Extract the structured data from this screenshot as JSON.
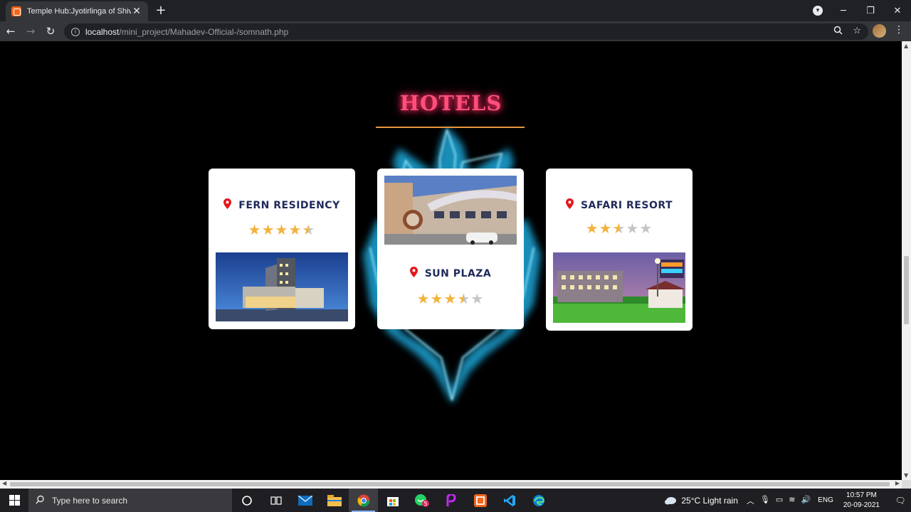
{
  "browser": {
    "tab_title": "Temple Hub:Jyotirlinga of Shiva",
    "tab_close": "✕",
    "new_tab": "+",
    "url_host": "localhost",
    "url_path": "/mini_project/Mahadev-Official-/somnath.php"
  },
  "page": {
    "section_title": "HOTELS",
    "hotels": [
      {
        "name": "FERN RESIDENCY",
        "rating": 4.5,
        "stars": [
          "full",
          "full",
          "full",
          "full",
          "half"
        ],
        "image": "hotel-building-blue-sky"
      },
      {
        "name": "SUN PLAZA",
        "rating": 3.5,
        "stars": [
          "full",
          "full",
          "full",
          "half",
          "empty"
        ],
        "image": "hotel-facade-with-car"
      },
      {
        "name": "SAFARI RESORT",
        "rating": 2.5,
        "stars": [
          "full",
          "full",
          "half",
          "empty",
          "empty"
        ],
        "image": "resort-lawn-at-night"
      }
    ]
  },
  "taskbar": {
    "search_placeholder": "Type here to search",
    "weather": "25°C  Light rain",
    "language": "ENG",
    "time": "10:57 PM",
    "date": "20-09-2021",
    "whatsapp_badge": "5"
  },
  "colors": {
    "title": "#ff4f7b",
    "rule": "#e7963f",
    "hotel_name": "#1f2a5a",
    "pin": "#e3161b",
    "star_full": "#f2b33d",
    "star_empty": "#c5c5c5"
  }
}
